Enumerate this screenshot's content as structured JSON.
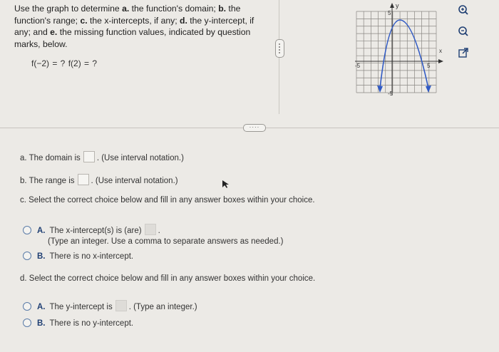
{
  "question": {
    "parts": [
      {
        "t": "Use the graph to determine ",
        "b": false
      },
      {
        "t": "a.",
        "b": true
      },
      {
        "t": " the function's domain; ",
        "b": false
      },
      {
        "t": "b.",
        "b": true
      },
      {
        "t": " the function's range; ",
        "b": false
      },
      {
        "t": "c.",
        "b": true
      },
      {
        "t": " the x-intercepts, if any; ",
        "b": false
      },
      {
        "t": "d.",
        "b": true
      },
      {
        "t": " the y-intercept, if any; and ",
        "b": false
      },
      {
        "t": "e.",
        "b": true
      },
      {
        "t": " the missing function values, indicated by question marks, below.",
        "b": false
      }
    ],
    "function_values": "f(−2) = ?   f(2) = ?"
  },
  "graph": {
    "y_label": "y",
    "x_label": "x",
    "top_tick": "5",
    "bottom_tick": "-5",
    "left_tick": "-5",
    "right_tick": "5",
    "curve_color": "#2f59c4"
  },
  "tools": [
    {
      "name": "zoom-in-icon"
    },
    {
      "name": "zoom-out-icon"
    },
    {
      "name": "open-external-icon"
    }
  ],
  "handle_dots": "····",
  "part_a": {
    "before": "a. The domain is",
    "after": ". (Use interval notation.)"
  },
  "part_b": {
    "before": "b. The range is",
    "after": ". (Use interval notation.)"
  },
  "part_c": {
    "prompt": "c. Select the correct choice below and fill in any answer boxes within your choice.",
    "option_a_letter": "A.",
    "option_a_text": "The x-intercept(s) is (are)",
    "option_a_after": ".",
    "option_a_hint": "(Type an integer. Use a comma to separate answers as needed.)",
    "option_b_letter": "B.",
    "option_b_text": "There is no x-intercept."
  },
  "part_d": {
    "prompt": "d. Select the correct choice below and fill in any answer boxes within your choice.",
    "option_a_letter": "A.",
    "option_a_text": "The y-intercept is",
    "option_a_after": ". (Type an integer.)",
    "option_b_letter": "B.",
    "option_b_text": "There is no y-intercept."
  }
}
